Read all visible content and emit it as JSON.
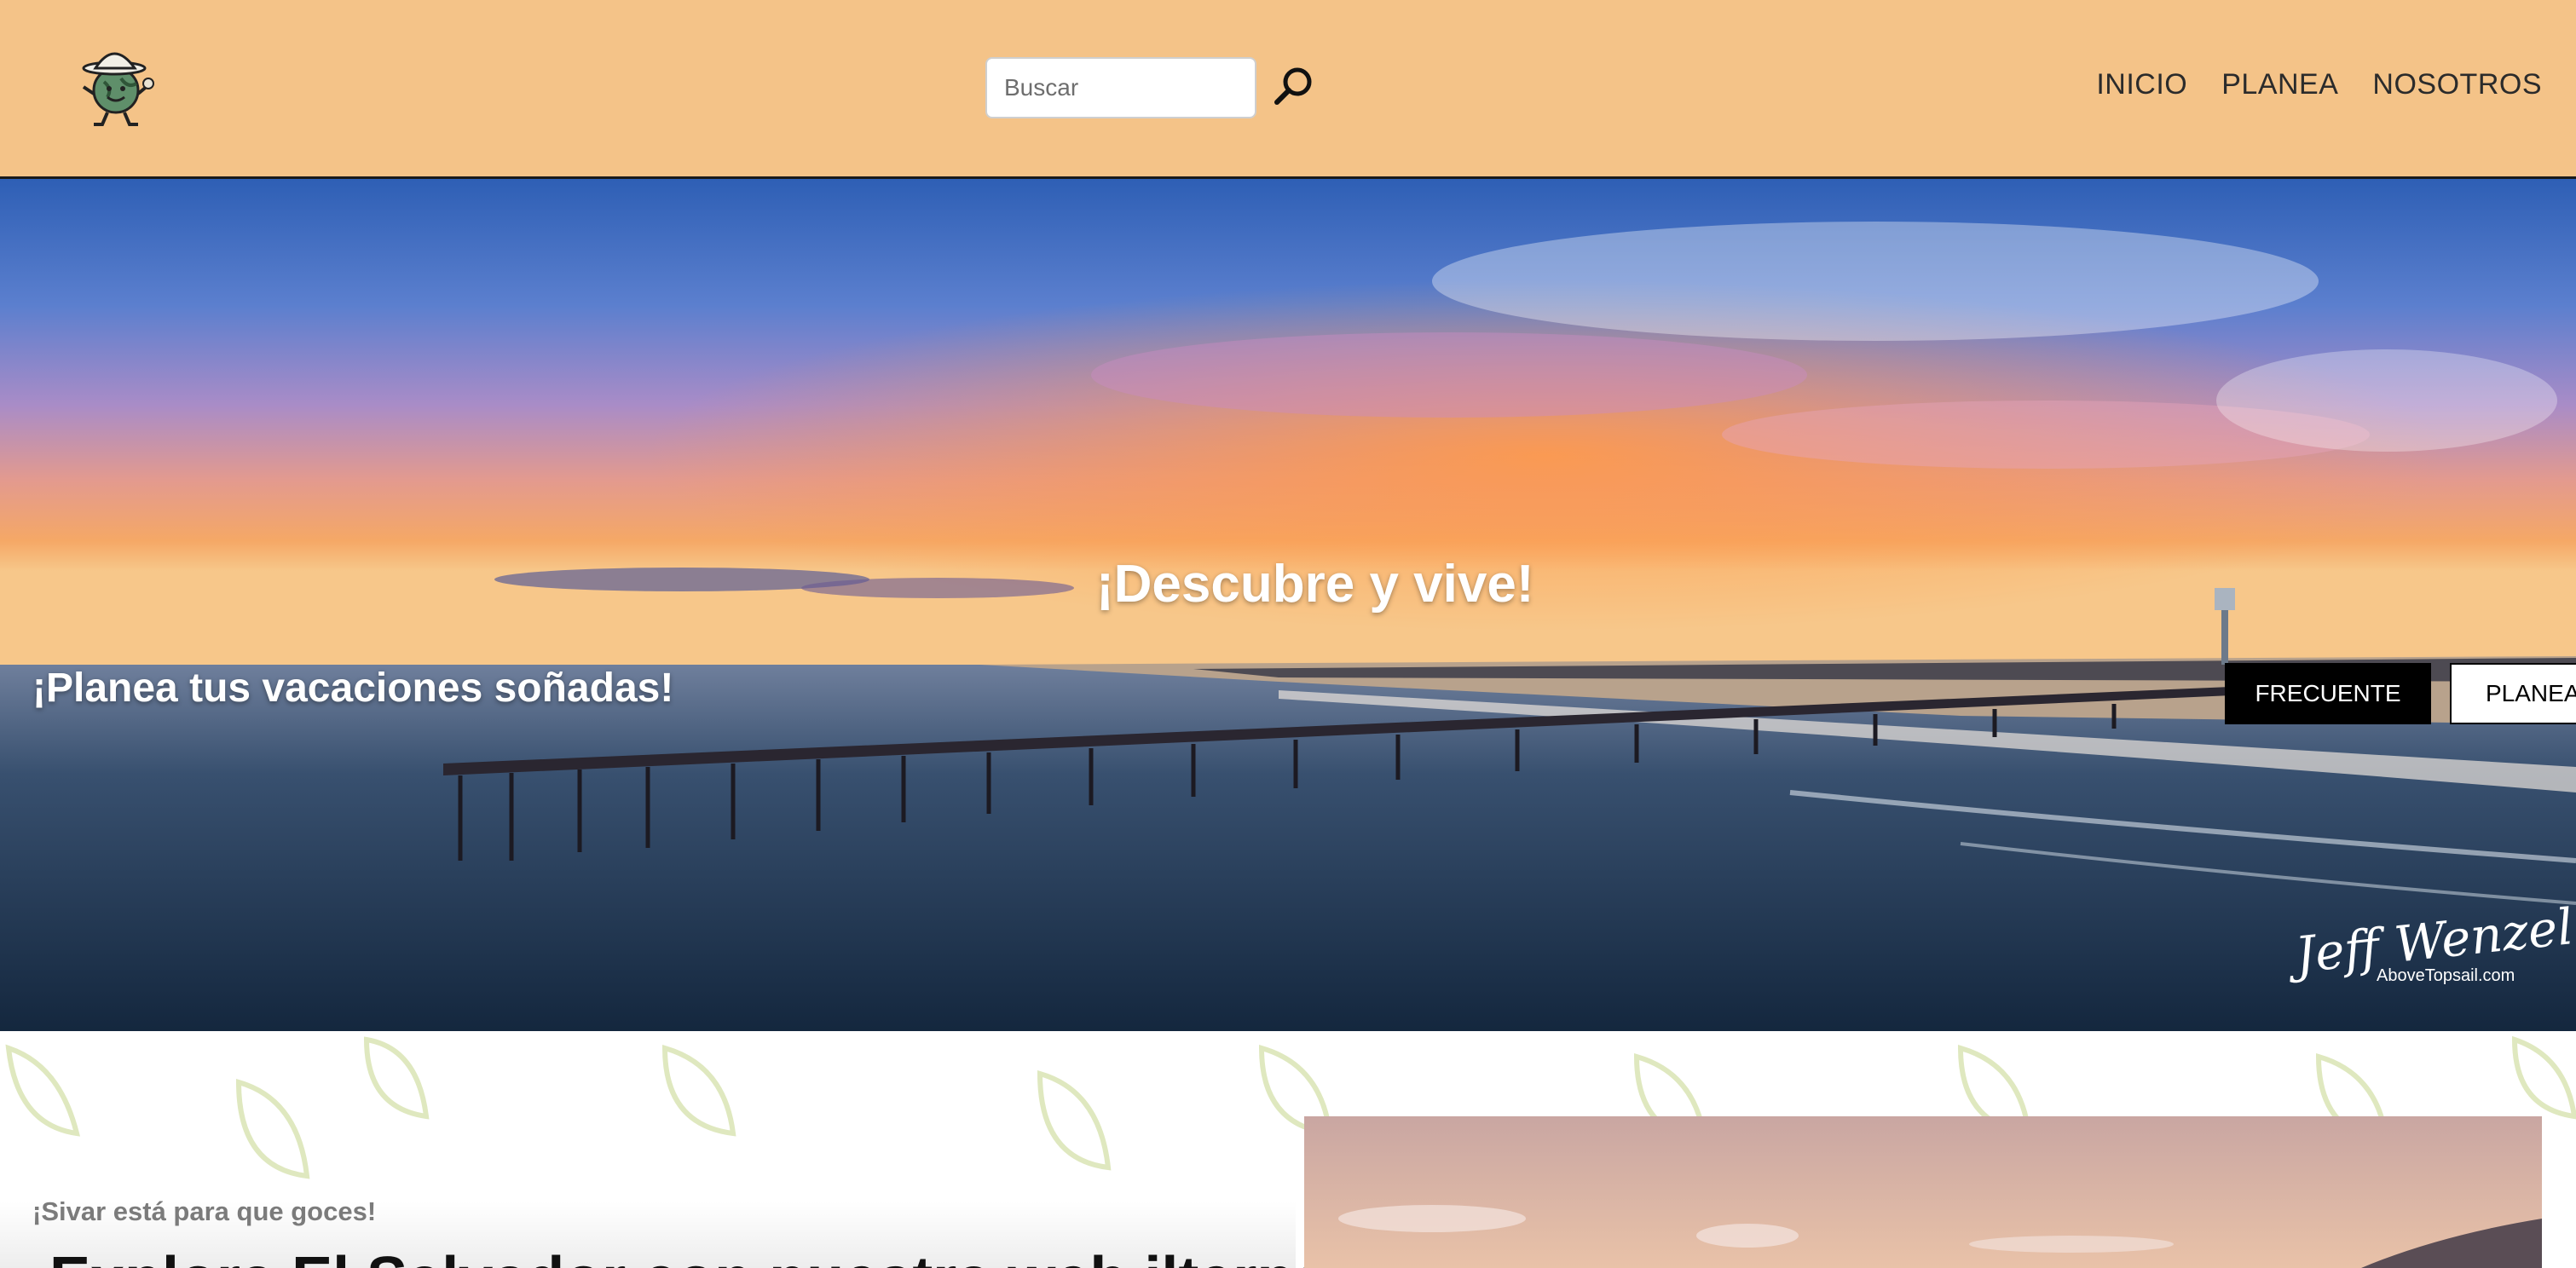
{
  "header": {
    "logo_icon": "explorer-globe-mascot-icon",
    "search": {
      "placeholder": "Buscar",
      "value": "",
      "icon": "magnifier-icon"
    },
    "nav": [
      {
        "label": "INICIO"
      },
      {
        "label": "PLANEA"
      },
      {
        "label": "NOSOTROS"
      }
    ],
    "background": "#f4c388"
  },
  "hero": {
    "title": "¡Descubre y vive!",
    "subtitle": "¡Planea tus vacaciones soñadas!",
    "buttons": [
      {
        "label": "FRECUENTE"
      },
      {
        "label": "PLANEA"
      }
    ],
    "watermark": {
      "name": "Jeff Wenzel",
      "site": "AboveTopsail.com"
    }
  },
  "intro": {
    "tagline": "¡Sivar está para que goces!",
    "heading": "Explora El Salvador con nuestra web ilternativa"
  },
  "colors": {
    "primary_button": "#000000",
    "secondary_button": "#ffffff",
    "accent": "#f4c388"
  }
}
